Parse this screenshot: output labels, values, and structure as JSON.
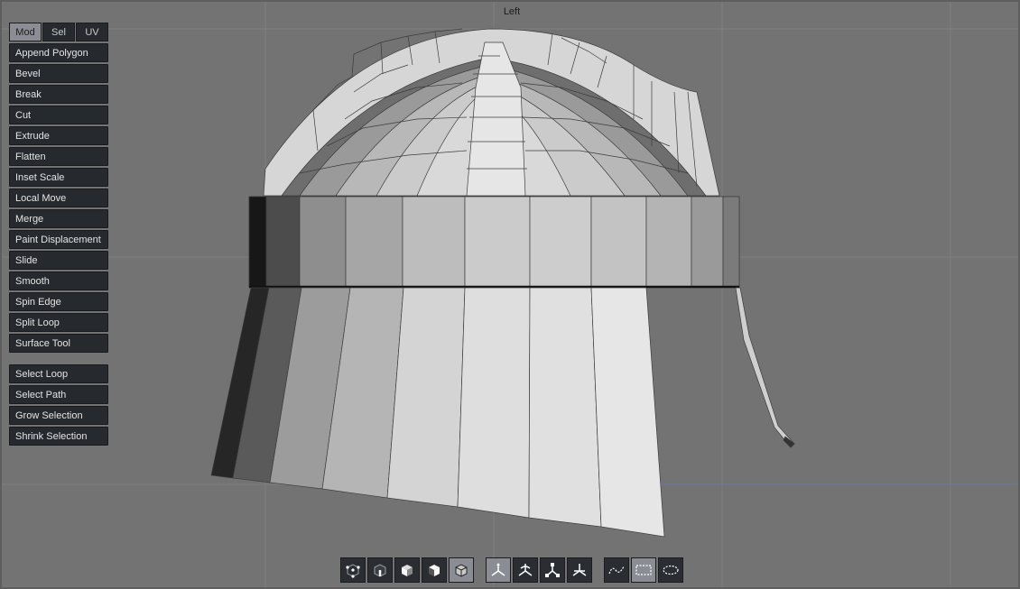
{
  "viewport": {
    "label": "Left"
  },
  "tabs": [
    {
      "label": "Mod",
      "active": true
    },
    {
      "label": "Sel",
      "active": false
    },
    {
      "label": "UV",
      "active": false
    }
  ],
  "tools": {
    "append_polygon": "Append Polygon",
    "bevel": "Bevel",
    "break": "Break",
    "cut": "Cut",
    "extrude": "Extrude",
    "flatten": "Flatten",
    "inset_scale": "Inset Scale",
    "local_move": "Local Move",
    "merge": "Merge",
    "paint_displacement": "Paint Displacement",
    "slide": "Slide",
    "smooth": "Smooth",
    "spin_edge": "Spin Edge",
    "split_loop": "Split Loop",
    "surface_tool": "Surface Tool"
  },
  "selection_tools": {
    "select_loop": "Select Loop",
    "select_path": "Select Path",
    "grow_selection": "Grow Selection",
    "shrink_selection": "Shrink Selection"
  },
  "toolbar": {
    "mesh_modes": [
      "vertex-mode-icon",
      "edge-mode-icon",
      "face-mode-icon",
      "object-mode-icon",
      "solid-mode-icon"
    ],
    "transform_modes": [
      "move-gizmo-icon",
      "rotate-gizmo-icon",
      "scale-gizmo-icon",
      "universal-gizmo-icon"
    ],
    "select_modes": [
      "lasso-select-icon",
      "rect-select-icon",
      "paint-select-icon"
    ],
    "active": [
      "solid-mode-icon",
      "move-gizmo-icon",
      "rect-select-icon"
    ]
  },
  "colors": {
    "viewport_bg": "#737373",
    "button_bg": "#262a2f",
    "active_tab": "#8a8e94"
  }
}
